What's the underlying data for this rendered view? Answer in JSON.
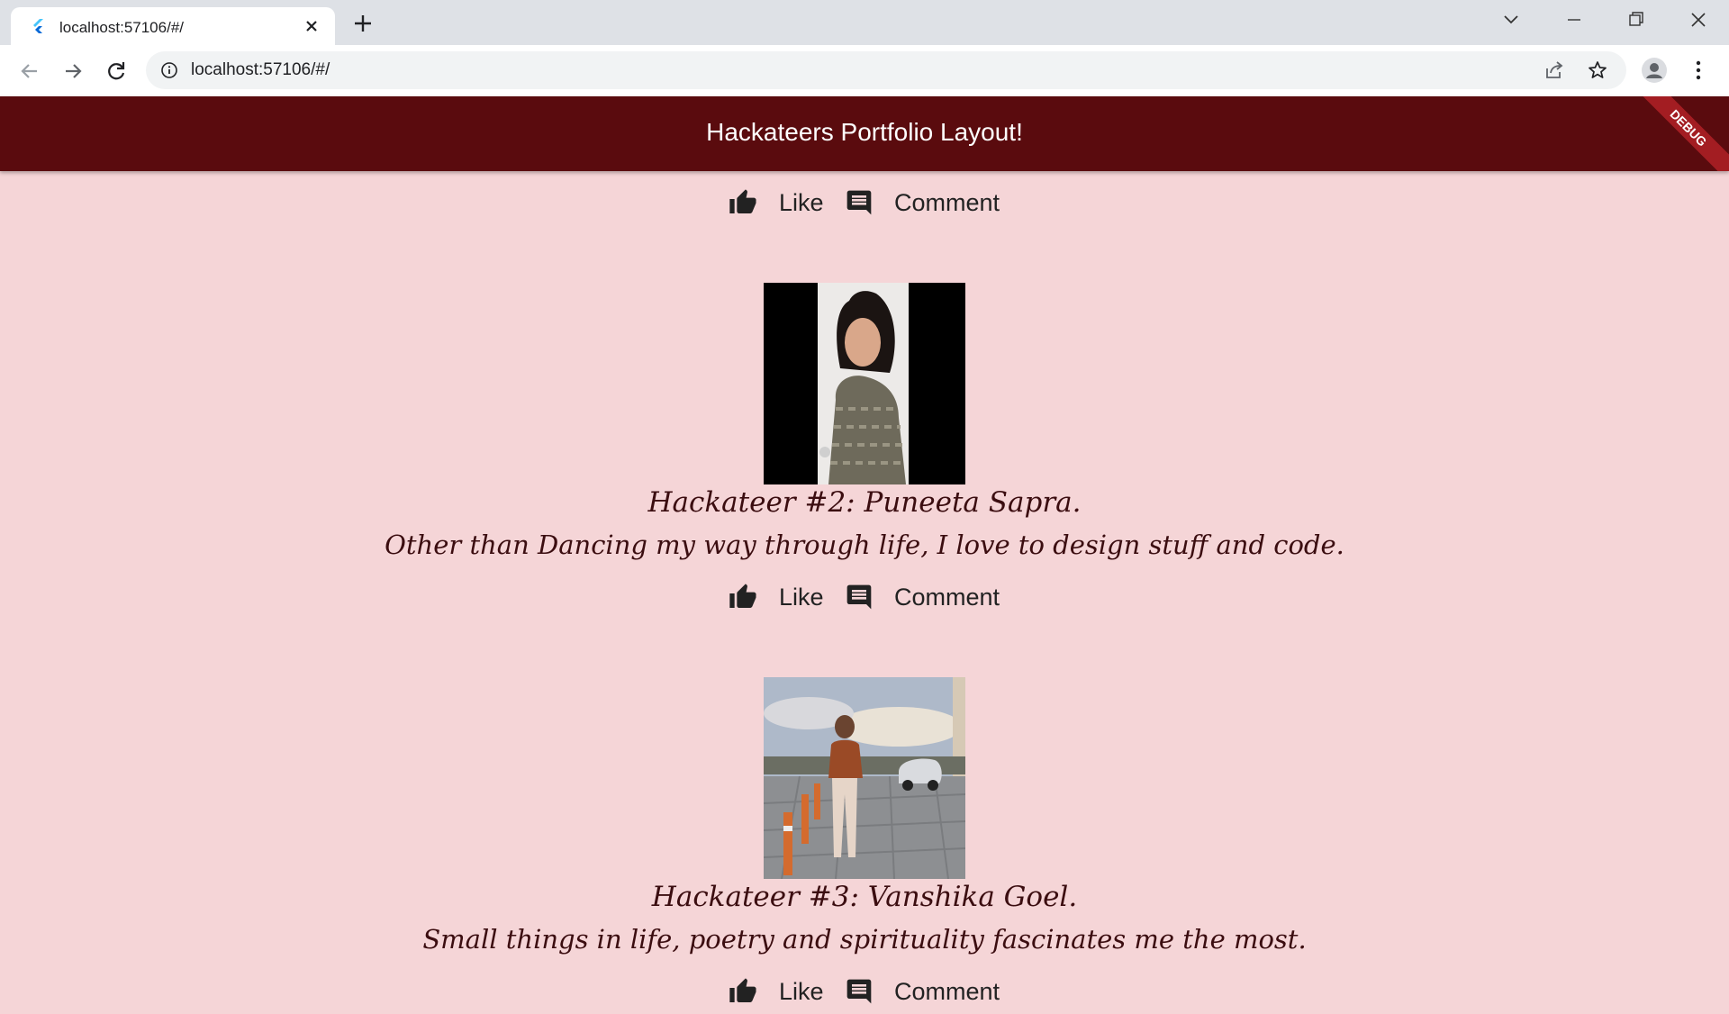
{
  "browser": {
    "tab_title": "localhost:57106/#/",
    "url": "localhost:57106/#/"
  },
  "app": {
    "title": "Hackateers Portfolio Layout!",
    "debug_banner": "DEBUG",
    "colors": {
      "appbar": "#5a0b0e",
      "background": "#f5d5d7",
      "text": "#3b0d10"
    }
  },
  "actions": {
    "like_label": "Like",
    "comment_label": "Comment"
  },
  "posts": [
    {
      "name": "Hackateer #2: Puneeta Sapra.",
      "bio": "Other than Dancing my way through life, I love to design stuff and code."
    },
    {
      "name": "Hackateer #3: Vanshika Goel.",
      "bio": "Small things in life, poetry and spirituality fascinates me the most."
    }
  ]
}
